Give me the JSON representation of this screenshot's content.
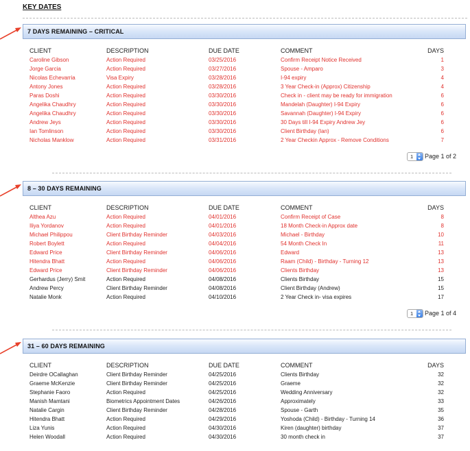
{
  "page_title": "KEY DATES",
  "columns": {
    "client": "CLIENT",
    "description": "DESCRIPTION",
    "due_date": "DUE DATE",
    "comment": "COMMENT",
    "days": "DAYS"
  },
  "colors": {
    "urgent_text": "#e0302c",
    "normal_text": "#222222",
    "header_gradient_end": "#c6d8f3",
    "arrow": "#e8402a"
  },
  "sections": [
    {
      "title": "7 DAYS REMAINING – CRITICAL",
      "pager": {
        "value": "1",
        "text": "Page 1 of 2"
      },
      "rows": [
        {
          "client": "Caroline Gibson",
          "description": "Action Required",
          "due_date": "03/25/2016",
          "comment": "Confirm Receipt Notice Received",
          "days": "1",
          "urgent": true
        },
        {
          "client": "Jorge Garcia",
          "description": "Action Required",
          "due_date": "03/27/2016",
          "comment": "Spouse - Amparo",
          "days": "3",
          "urgent": true
        },
        {
          "client": "Nicolas Echevarria",
          "description": "Visa Expiry",
          "due_date": "03/28/2016",
          "comment": "I-94 expiry",
          "days": "4",
          "urgent": true
        },
        {
          "client": "Antony Jones",
          "description": "Action Required",
          "due_date": "03/28/2016",
          "comment": "3 Year Check-in (Approx) Citizenship",
          "days": "4",
          "urgent": true
        },
        {
          "client": "Paras Doshi",
          "description": "Action Required",
          "due_date": "03/30/2016",
          "comment": "Check in - client may be ready for immigration",
          "days": "6",
          "urgent": true
        },
        {
          "client": "Angelika Chaudhry",
          "description": "Action Required",
          "due_date": "03/30/2016",
          "comment": "Mandelah (Daughter) I-94 Expiry",
          "days": "6",
          "urgent": true
        },
        {
          "client": "Angelika Chaudhry",
          "description": "Action Required",
          "due_date": "03/30/2016",
          "comment": "Savannah (Daughter) I-94 Expiry",
          "days": "6",
          "urgent": true
        },
        {
          "client": "Andrew Jeys",
          "description": "Action Required",
          "due_date": "03/30/2016",
          "comment": "30 Days till I-94 Expiry Andrew Jey",
          "days": "6",
          "urgent": true
        },
        {
          "client": "Ian Tomlinson",
          "description": "Action Required",
          "due_date": "03/30/2016",
          "comment": "Client Birthday (Ian)",
          "days": "6",
          "urgent": true
        },
        {
          "client": "Nicholas Manklow",
          "description": "Action Required",
          "due_date": "03/31/2016",
          "comment": "2 Year Checkin Approx - Remove Conditions",
          "days": "7",
          "urgent": true
        }
      ]
    },
    {
      "title": "8 – 30 DAYS REMAINING",
      "pager": {
        "value": "1",
        "text": "Page 1 of 4"
      },
      "rows": [
        {
          "client": "Althea Azu",
          "description": "Action Required",
          "due_date": "04/01/2016",
          "comment": "Confirm Receipt of Case",
          "days": "8",
          "urgent": true
        },
        {
          "client": "Iliya Yordanov",
          "description": "Action Required",
          "due_date": "04/01/2016",
          "comment": "18 Month Check-in Approx date",
          "days": "8",
          "urgent": true
        },
        {
          "client": "Michael Philippou",
          "description": "Client Birthday Reminder",
          "due_date": "04/03/2016",
          "comment": "Michael - Birthday",
          "days": "10",
          "urgent": true
        },
        {
          "client": "Robert Boylett",
          "description": "Action Required",
          "due_date": "04/04/2016",
          "comment": "54 Month Check In",
          "days": "11",
          "urgent": true
        },
        {
          "client": "Edward Price",
          "description": "Client Birthday Reminder",
          "due_date": "04/06/2016",
          "comment": "Edward",
          "days": "13",
          "urgent": true
        },
        {
          "client": "Hitendra Bhatt",
          "description": "Action Required",
          "due_date": "04/06/2016",
          "comment": "Raam (Child) - Birthday - Turning 12",
          "days": "13",
          "urgent": true
        },
        {
          "client": "Edward Price",
          "description": "Client Birthday Reminder",
          "due_date": "04/06/2016",
          "comment": "Clients Birthday",
          "days": "13",
          "urgent": true
        },
        {
          "client": "Gerhardus (Jerry) Smit",
          "description": "Action Required",
          "due_date": "04/08/2016",
          "comment": "Clients Birthday",
          "days": "15",
          "urgent": false
        },
        {
          "client": "Andrew Percy",
          "description": "Client Birthday Reminder",
          "due_date": "04/08/2016",
          "comment": "Client Birthday (Andrew)",
          "days": "15",
          "urgent": false
        },
        {
          "client": "Natalie Monk",
          "description": "Action Required",
          "due_date": "04/10/2016",
          "comment": "2 Year Check in- visa expires",
          "days": "17",
          "urgent": false
        }
      ]
    },
    {
      "title": "31 – 60 DAYS REMAINING",
      "pager": null,
      "rows": [
        {
          "client": "Deirdre OCallaghan",
          "description": "Client Birthday Reminder",
          "due_date": "04/25/2016",
          "comment": "Clients Birthday",
          "days": "32",
          "urgent": false
        },
        {
          "client": "Graeme McKenzie",
          "description": "Client Birthday Reminder",
          "due_date": "04/25/2016",
          "comment": "Graeme",
          "days": "32",
          "urgent": false
        },
        {
          "client": "Stephanie Faoro",
          "description": "Action Required",
          "due_date": "04/25/2016",
          "comment": "Wedding Anniversary",
          "days": "32",
          "urgent": false
        },
        {
          "client": "Manish Mamtani",
          "description": "Biometrics Appointment Dates",
          "due_date": "04/26/2016",
          "comment": "Approximately",
          "days": "33",
          "urgent": false
        },
        {
          "client": "Natalie Cargin",
          "description": "Client Birthday Reminder",
          "due_date": "04/28/2016",
          "comment": "Spouse - Garth",
          "days": "35",
          "urgent": false
        },
        {
          "client": "Hitendra Bhatt",
          "description": "Action Required",
          "due_date": "04/29/2016",
          "comment": "Yoshoda (Child) - Birthday - Turning 14",
          "days": "36",
          "urgent": false
        },
        {
          "client": "Liza Yunis",
          "description": "Action Required",
          "due_date": "04/30/2016",
          "comment": "Kiren (daughter) birthday",
          "days": "37",
          "urgent": false
        },
        {
          "client": "Helen Woodall",
          "description": "Action Required",
          "due_date": "04/30/2016",
          "comment": "30 month check in",
          "days": "37",
          "urgent": false
        }
      ]
    }
  ]
}
